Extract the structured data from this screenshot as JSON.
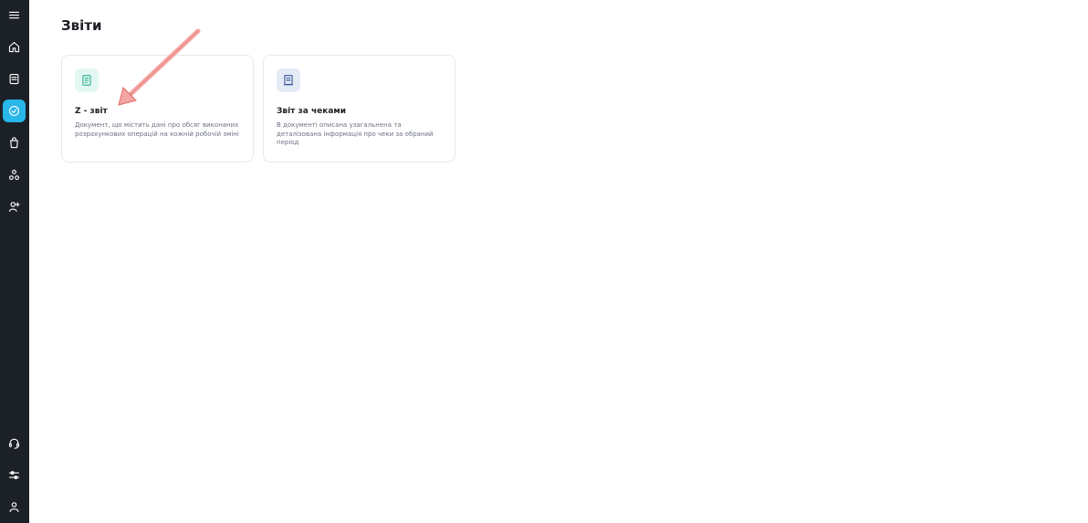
{
  "sidebar": {
    "items": [
      {
        "name": "menu-icon",
        "active": false
      },
      {
        "name": "home-icon",
        "active": false
      },
      {
        "name": "document-icon",
        "active": false
      },
      {
        "name": "reports-icon",
        "active": true
      },
      {
        "name": "shopping-bag-icon",
        "active": false
      },
      {
        "name": "connections-icon",
        "active": false
      },
      {
        "name": "user-add-icon",
        "active": false
      },
      {
        "name": "support-headset-icon",
        "active": false
      },
      {
        "name": "settings-sliders-icon",
        "active": false
      },
      {
        "name": "profile-icon",
        "active": false
      }
    ]
  },
  "page": {
    "title": "Звіти"
  },
  "cards": [
    {
      "title": "Z - звіт",
      "description": "Документ, що містить дані про обсяг виконаних розрахункових операцій на кожній робочій зміні",
      "icon": "z-report-icon",
      "icon_bg": "#e3f7f3",
      "icon_color": "#13a886"
    },
    {
      "title": "Звіт за чеками",
      "description": "В документі описана узагальнена та деталізована інформація про чеки за обраний період",
      "icon": "receipt-icon",
      "icon_bg": "#e4ebf6",
      "icon_color": "#1f3e8a"
    }
  ],
  "colors": {
    "sidebar_bg": "#1c2128",
    "active_accent": "#29b6e8",
    "annotation_arrow": "#f08b88"
  }
}
